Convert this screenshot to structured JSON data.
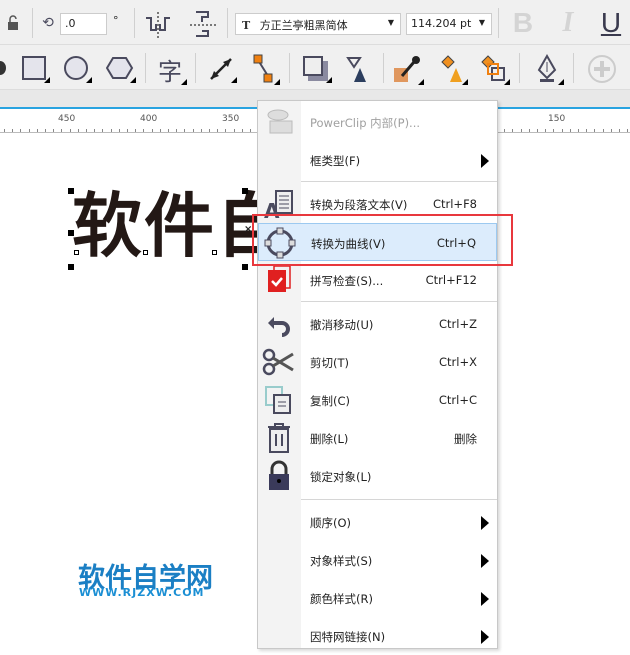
{
  "toolbar": {
    "rotation_value": ".0",
    "degree_symbol": "°",
    "font_name": "方正兰亭粗黑简体",
    "font_size": "114.204 pt",
    "bold_label": "B",
    "italic_label": "I",
    "underline_label": "U",
    "char_label": "字"
  },
  "ruler": {
    "ticks": [
      "450",
      "400",
      "350",
      "150"
    ]
  },
  "canvas": {
    "text": "软件自",
    "watermark_cn": "软件自学网",
    "watermark_url": "WWW.RJZXW.COM"
  },
  "menu": {
    "items": [
      {
        "label": "PowerClip 内部(P)...",
        "shortcut": "",
        "icon": "powerclip-icon",
        "disabled": true
      },
      {
        "label": "框类型(F)",
        "shortcut": "",
        "submenu": true
      },
      {
        "label": "转换为段落文本(V)",
        "shortcut": "Ctrl+F8",
        "icon": "paragraph-text-icon"
      },
      {
        "label": "转换为曲线(V)",
        "shortcut": "Ctrl+Q",
        "icon": "curve-icon",
        "highlighted": true
      },
      {
        "label": "拼写检查(S)...",
        "shortcut": "Ctrl+F12",
        "icon": "spellcheck-icon"
      },
      {
        "label": "撤消移动(U)",
        "shortcut": "Ctrl+Z",
        "icon": "undo-icon"
      },
      {
        "label": "剪切(T)",
        "shortcut": "Ctrl+X",
        "icon": "scissors-icon"
      },
      {
        "label": "复制(C)",
        "shortcut": "Ctrl+C",
        "icon": "copy-icon"
      },
      {
        "label": "删除(L)",
        "shortcut": "删除",
        "icon": "trash-icon"
      },
      {
        "label": "锁定对象(L)",
        "shortcut": "",
        "icon": "lock-icon"
      },
      {
        "label": "顺序(O)",
        "shortcut": "",
        "submenu": true
      },
      {
        "label": "对象样式(S)",
        "shortcut": "",
        "submenu": true
      },
      {
        "label": "颜色样式(R)",
        "shortcut": "",
        "submenu": true
      },
      {
        "label": "因特网链接(N)",
        "shortcut": "",
        "submenu": true
      }
    ]
  },
  "colors": {
    "highlight_box": "#e8383d",
    "accent": "#29a3e0",
    "watermark": "#1b7fc4"
  }
}
